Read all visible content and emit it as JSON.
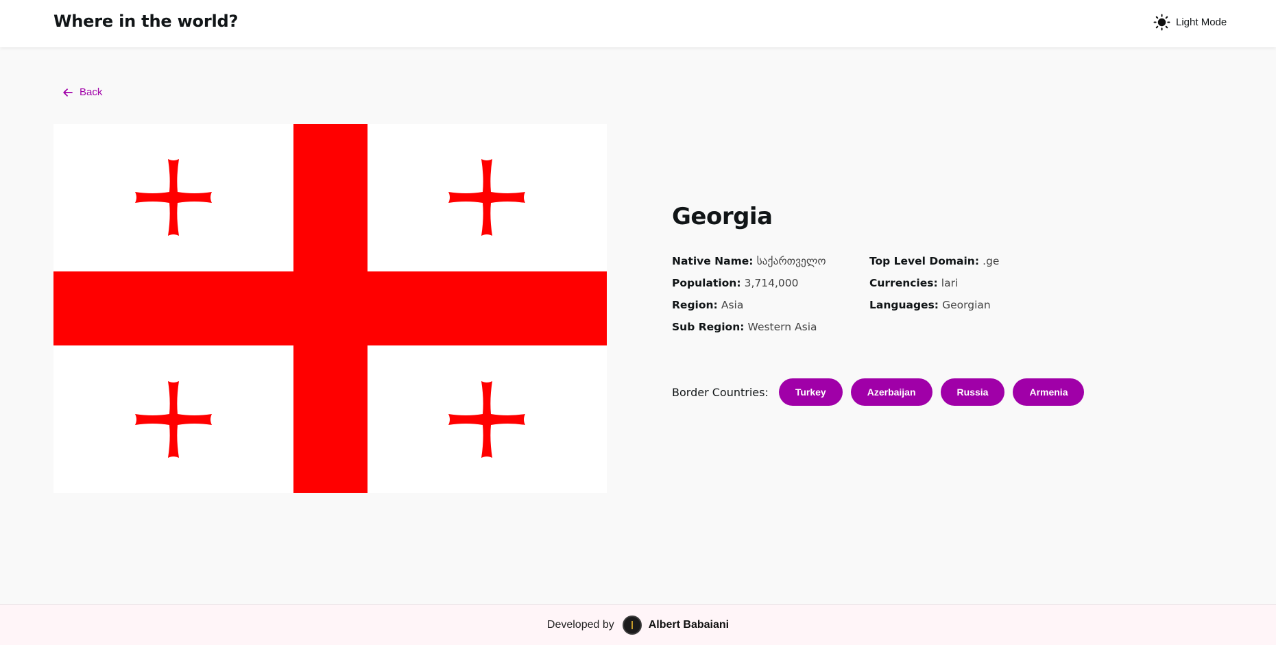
{
  "header": {
    "title": "Where in the world?",
    "mode_label": "Light Mode",
    "mode_icon": "sun-icon"
  },
  "back": {
    "label": "Back",
    "icon": "arrow-left-icon"
  },
  "country": {
    "name": "Georgia",
    "flag": {
      "description_icon": "flag-of-georgia",
      "colors": {
        "field": "#ffffff",
        "cross": "#ff0000"
      }
    },
    "left_details": [
      {
        "key": "Native Name:",
        "value": "საქართველო"
      },
      {
        "key": "Population:",
        "value": "3,714,000"
      },
      {
        "key": "Region:",
        "value": "Asia"
      },
      {
        "key": "Sub Region:",
        "value": "Western Asia"
      }
    ],
    "right_details": [
      {
        "key": "Top Level Domain:",
        "value": ".ge"
      },
      {
        "key": "Currencies:",
        "value": "lari"
      },
      {
        "key": "Languages:",
        "value": "Georgian"
      }
    ],
    "borders_label": "Border Countries:",
    "borders": [
      "Turkey",
      "Azerbaijan",
      "Russia",
      "Armenia"
    ]
  },
  "footer": {
    "developed_by": "Developed by",
    "author": "Albert Babaiani"
  },
  "theme": {
    "accent": "#a000a8",
    "background": "#f9f9f9",
    "header_bg": "#ffffff",
    "footer_bg": "#fff5f8"
  }
}
